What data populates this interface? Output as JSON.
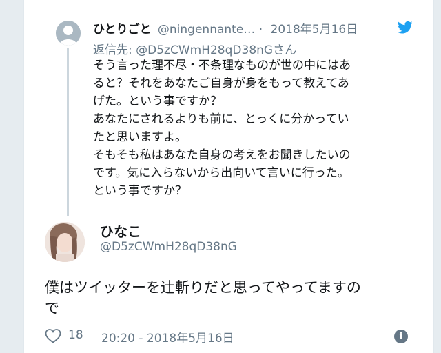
{
  "reply_tweet": {
    "name": "ひとりごと",
    "handle": "@ningennante…",
    "separator": "·",
    "date": "2018年5月16日",
    "reply_to_label": "返信先:",
    "reply_to_handle": "@D5zCWmH28qD38nG",
    "reply_to_suffix": "さん",
    "body_lines": [
      "そう言った理不尽・不条理なものが世の中にはあ",
      "ると？それをあなたご自身が身をもって教えてあ",
      "げた。という事ですか？",
      "あなたにされるよりも前に、とっくに分かってい",
      "たと思いますよ。",
      "そもそも私はあなた自身の考えをお聞きしたいの",
      "です。気に入らないから出向いて言いに行った。",
      "という事ですか？"
    ]
  },
  "main_tweet": {
    "name": "ひなこ",
    "handle": "@D5zCWmH28qD38nG",
    "text_lines": [
      "僕はツイッターを辻斬りだと思ってやってますの",
      "で"
    ],
    "like_count": "18",
    "timestamp": "20:20 - 2018年5月16日",
    "info_glyph": "i"
  },
  "colors": {
    "twitter_blue": "#1da1f2",
    "muted_gray": "#657786",
    "text_dark": "#14171a"
  },
  "icons": {
    "brand": "twitter-bird-icon",
    "like": "heart-icon",
    "info": "info-icon"
  }
}
